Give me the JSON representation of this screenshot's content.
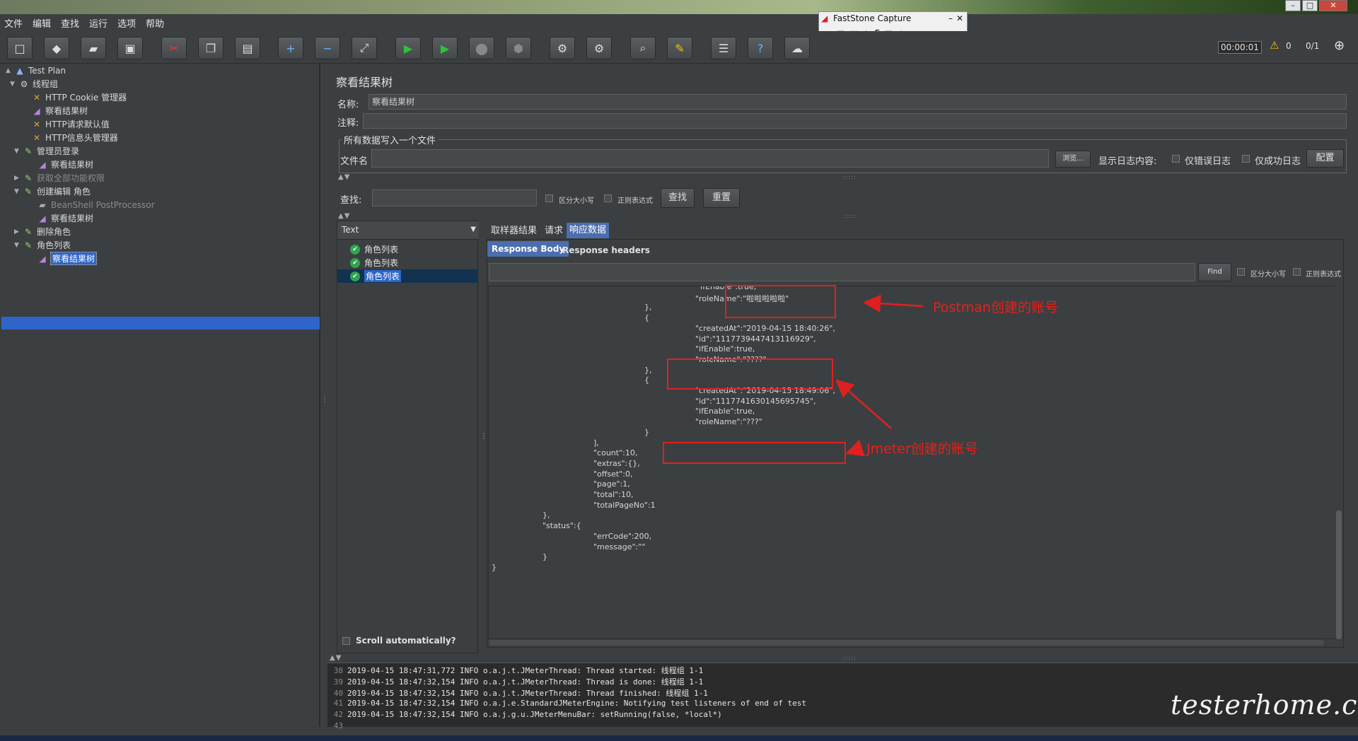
{
  "menu": [
    "文件",
    "编辑",
    "查找",
    "运行",
    "选项",
    "帮助"
  ],
  "faststone": {
    "title": "FastStone Capture"
  },
  "toolbar": {
    "timer": "00:00:01",
    "warnings": "0",
    "threads": "0/1"
  },
  "tree": [
    {
      "label": "Test Plan",
      "icon": "test-plan-icon"
    },
    {
      "label": "线程组",
      "icon": "gear-icon"
    },
    {
      "label": "HTTP Cookie 管理器",
      "icon": "wrench-icon"
    },
    {
      "label": "察看结果树",
      "icon": "chart-icon"
    },
    {
      "label": "HTTP请求默认值",
      "icon": "wrench-icon"
    },
    {
      "label": "HTTP信息头管理器",
      "icon": "wrench-icon"
    },
    {
      "label": "管理员登录",
      "icon": "pipette-icon"
    },
    {
      "label": "察看结果树",
      "icon": "chart-icon"
    },
    {
      "label": "获取全部功能权限",
      "icon": "pipette-icon"
    },
    {
      "label": "创建编辑 角色",
      "icon": "pipette-icon"
    },
    {
      "label": "BeanShell PostProcessor",
      "icon": "doc-icon"
    },
    {
      "label": "察看结果树",
      "icon": "chart-icon"
    },
    {
      "label": "删除角色",
      "icon": "pipette-icon"
    },
    {
      "label": "角色列表",
      "icon": "pipette-icon"
    },
    {
      "label": "察看结果树",
      "icon": "chart-icon"
    }
  ],
  "panel": {
    "title": "察看结果树",
    "name_label": "名称:",
    "name_value": "察看结果树",
    "comment_label": "注释:",
    "file_group": "所有数据写入一个文件",
    "file_label": "文件名",
    "browse": "浏览...",
    "log_label": "显示日志内容:",
    "errors_only": "仅错误日志",
    "success_only": "仅成功日志",
    "configure": "配置",
    "search_label": "查找:",
    "case_sensitive": "区分大小写",
    "regex": "正则表达式",
    "search_btn": "查找",
    "reset_btn": "重置"
  },
  "renderer": "Text",
  "samples": [
    "角色列表",
    "角色列表",
    "角色列表"
  ],
  "scroll_auto": "Scroll automatically?",
  "tabs": [
    "取样器结果",
    "请求",
    "响应数据"
  ],
  "subtabs": [
    "Response Body",
    "Response headers"
  ],
  "find_btn": "Find",
  "find_case": "区分大小写",
  "find_regex": "正则表达式",
  "json_lines": [
    "\"ifEnable\":true,",
    "\"roleName\":\"啦啦啦啦啦\"",
    "},",
    "{",
    "\"createdAt\":\"2019-04-15 18:40:26\",",
    "\"id\":\"1117739447413116929\",",
    "\"ifEnable\":true,",
    "\"roleName\":\"????\"",
    "},",
    "{",
    "\"createdAt\":\"2019-04-15 18:49:06\",",
    "\"id\":\"1117741630145695745\",",
    "\"ifEnable\":true,",
    "\"roleName\":\"???\"",
    "}",
    "],",
    "\"count\":10,",
    "\"extras\":{},",
    "\"offset\":0,",
    "\"page\":1,",
    "\"total\":10,",
    "\"totalPageNo\":1",
    "},",
    "\"status\":{",
    "\"errCode\":200,",
    "\"message\":\"\"",
    "}",
    "}"
  ],
  "annotations": {
    "postman": "Postman创建的账号",
    "jmeter": "Jmeter创建的账号"
  },
  "log": [
    {
      "n": "38",
      "text": "2019-04-15 18:47:31,772 INFO o.a.j.t.JMeterThread: Thread started: 线程组 1-1"
    },
    {
      "n": "39",
      "text": "2019-04-15 18:47:32,154 INFO o.a.j.t.JMeterThread: Thread is done: 线程组 1-1"
    },
    {
      "n": "40",
      "text": "2019-04-15 18:47:32,154 INFO o.a.j.t.JMeterThread: Thread finished: 线程组 1-1"
    },
    {
      "n": "41",
      "text": "2019-04-15 18:47:32,154 INFO o.a.j.e.StandardJMeterEngine: Notifying test listeners of end of test"
    },
    {
      "n": "42",
      "text": "2019-04-15 18:47:32,154 INFO o.a.j.g.u.JMeterMenuBar: setRunning(false, *local*)"
    },
    {
      "n": "43",
      "text": ""
    }
  ],
  "watermark": "testerhome.com"
}
